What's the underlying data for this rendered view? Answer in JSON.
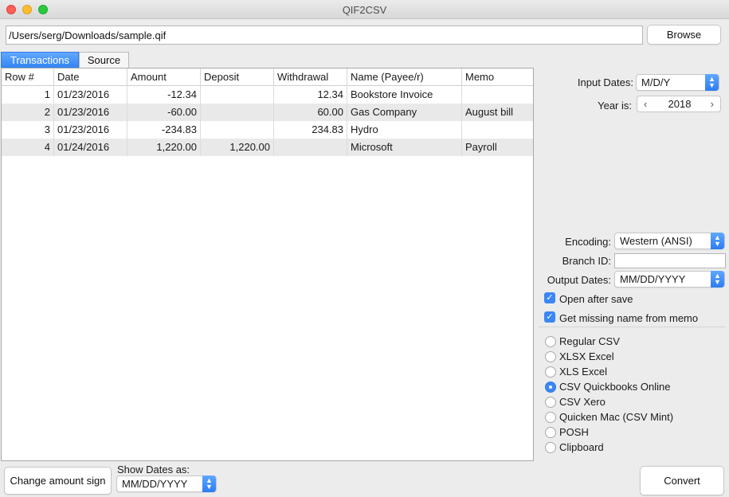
{
  "window": {
    "title": "QIF2CSV"
  },
  "file": {
    "path": "/Users/serg/Downloads/sample.qif",
    "browse_label": "Browse"
  },
  "tabs": [
    {
      "label": "Transactions"
    },
    {
      "label": "Source"
    }
  ],
  "table": {
    "headers": [
      "Row #",
      "Date",
      "Amount",
      "Deposit",
      "Withdrawal",
      "Name (Payee/r)",
      "Memo"
    ],
    "rows": [
      [
        "1",
        "01/23/2016",
        "-12.34",
        "",
        "12.34",
        "Bookstore Invoice",
        ""
      ],
      [
        "2",
        "01/23/2016",
        "-60.00",
        "",
        "60.00",
        "Gas Company",
        "August bill"
      ],
      [
        "3",
        "01/23/2016",
        "-234.83",
        "",
        "234.83",
        "Hydro",
        ""
      ],
      [
        "4",
        "01/24/2016",
        "1,220.00",
        "1,220.00",
        "",
        "Microsoft",
        "Payroll"
      ]
    ]
  },
  "settings": {
    "input_dates_label": "Input Dates:",
    "input_dates_value": "M/D/Y",
    "year_label": "Year is:",
    "year_value": "2018",
    "encoding_label": "Encoding:",
    "encoding_value": "Western (ANSI)",
    "branch_label": "Branch ID:",
    "branch_value": "",
    "output_dates_label": "Output Dates:",
    "output_dates_value": "MM/DD/YYYY",
    "open_after_save_label": "Open after save",
    "open_after_save_checked": true,
    "missing_name_label": "Get missing name from memo",
    "missing_name_checked": true
  },
  "formats": {
    "options": [
      "Regular CSV",
      "XLSX Excel",
      "XLS Excel",
      "CSV Quickbooks Online",
      "CSV Xero",
      "Quicken Mac (CSV Mint)",
      "POSH",
      "Clipboard"
    ],
    "selected": "CSV Quickbooks Online"
  },
  "bottom": {
    "change_sign_label": "Change amount sign",
    "show_dates_label": "Show Dates as:",
    "show_dates_value": "MM/DD/YYYY",
    "convert_label": "Convert"
  },
  "colors": {
    "accent": "#3b87f5",
    "alt_row": "#e9e9e9"
  },
  "icons": {
    "stepper_prev": "‹",
    "stepper_next": "›",
    "popup_arrows": "chevron-up-down-icon",
    "checkmark": "✓"
  }
}
